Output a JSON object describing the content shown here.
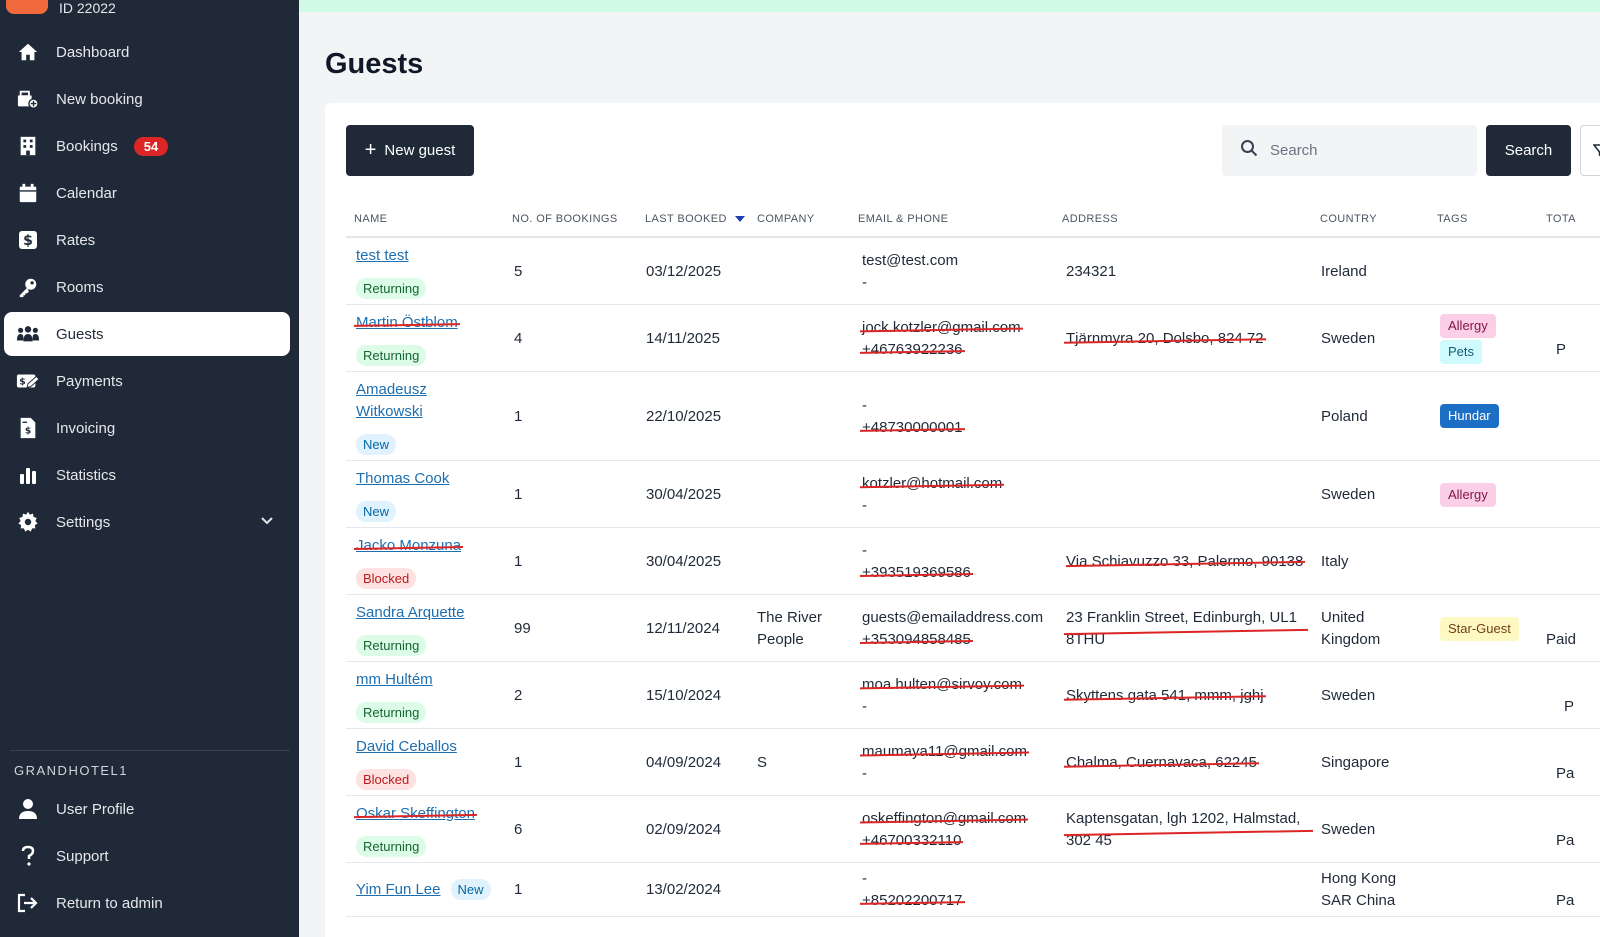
{
  "app": {
    "property_id": "ID 22022",
    "page_title": "Guests",
    "section_title": "GRANDHOTEL1"
  },
  "sidebar": {
    "items": [
      {
        "label": "Dashboard",
        "icon": "home-icon"
      },
      {
        "label": "New booking",
        "icon": "new-booking-icon"
      },
      {
        "label": "Bookings",
        "icon": "building-icon",
        "badge": "54"
      },
      {
        "label": "Calendar",
        "icon": "calendar-icon"
      },
      {
        "label": "Rates",
        "icon": "dollar-icon"
      },
      {
        "label": "Rooms",
        "icon": "key-icon"
      },
      {
        "label": "Guests",
        "icon": "people-icon",
        "active": true
      },
      {
        "label": "Payments",
        "icon": "payment-icon"
      },
      {
        "label": "Invoicing",
        "icon": "invoice-icon"
      },
      {
        "label": "Statistics",
        "icon": "chart-icon"
      },
      {
        "label": "Settings",
        "icon": "gear-icon"
      }
    ],
    "bottom_items": [
      {
        "label": "User Profile",
        "icon": "user-icon"
      },
      {
        "label": "Support",
        "icon": "question-icon"
      },
      {
        "label": "Return to admin",
        "icon": "exit-icon"
      }
    ]
  },
  "toolbar": {
    "new_guest_label": "New guest",
    "search_placeholder": "Search",
    "search_button_label": "Search"
  },
  "table": {
    "columns": [
      "NAME",
      "NO. OF BOOKINGS",
      "LAST BOOKED",
      "COMPANY",
      "EMAIL & PHONE",
      "ADDRESS",
      "COUNTRY",
      "TAGS",
      "TOTA"
    ],
    "rows": [
      {
        "name": "test test",
        "status": "Returning",
        "bookings": "5",
        "last_booked": "03/12/2025",
        "company": "",
        "email": "test@test.com",
        "phone": "-",
        "address": "234321",
        "country": "Ireland",
        "tags": [],
        "total": ""
      },
      {
        "name": "Martin Östblom",
        "status": "Returning",
        "bookings": "4",
        "last_booked": "14/11/2025",
        "company": "",
        "email": "jock.kotzler@gmail.com",
        "phone": "+46763922236",
        "address": "Tjärnmyra 20, Dolsbo, 824 72",
        "country": "Sweden",
        "tags": [
          "Allergy",
          "Pets"
        ],
        "total": "P"
      },
      {
        "name": "Amadeusz Witkowski",
        "status": "New",
        "bookings": "1",
        "last_booked": "22/10/2025",
        "company": "",
        "email": "-",
        "phone": "+48730000001",
        "address": "",
        "country": "Poland",
        "tags": [
          "Hundar"
        ],
        "total": ""
      },
      {
        "name": "Thomas Cook",
        "status": "New",
        "bookings": "1",
        "last_booked": "30/04/2025",
        "company": "",
        "email": "kotzler@hotmail.com",
        "phone": "-",
        "address": "",
        "country": "Sweden",
        "tags": [
          "Allergy"
        ],
        "total": ""
      },
      {
        "name": "Jacko Monzuna",
        "status": "Blocked",
        "bookings": "1",
        "last_booked": "30/04/2025",
        "company": "",
        "email": "-",
        "phone": "+393519369586",
        "address": "Via Schiavuzzo 33, Palermo, 90138",
        "country": "Italy",
        "tags": [],
        "total": ""
      },
      {
        "name": "Sandra Arquette",
        "status": "Returning",
        "bookings": "99",
        "last_booked": "12/11/2024",
        "company": "The River People",
        "email": "guests@emailaddress.com",
        "phone": "+353094858485",
        "address": "23 Franklin Street, Edinburgh, UL1 8THU",
        "country": "United Kingdom",
        "tags": [
          "Star-Guest"
        ],
        "total": "Paid"
      },
      {
        "name": "mm Hultém",
        "status": "Returning",
        "bookings": "2",
        "last_booked": "15/10/2024",
        "company": "",
        "email": "moa.hulten@sirvoy.com",
        "phone": "-",
        "address": "Skyttens gata 541, mmm, jghj",
        "country": "Sweden",
        "tags": [],
        "total": "P"
      },
      {
        "name": "David Ceballos",
        "status": "Blocked",
        "bookings": "1",
        "last_booked": "04/09/2024",
        "company": "S",
        "email": "maumaya11@gmail.com",
        "phone": "-",
        "address": "Chalma, Cuernavaca, 62245",
        "country": "Singapore",
        "tags": [],
        "total": "Pa"
      },
      {
        "name": "Oskar Skeffington",
        "status": "Returning",
        "bookings": "6",
        "last_booked": "02/09/2024",
        "company": "",
        "email": "oskeffington@gmail.com",
        "phone": "+46700332110",
        "address": "Kaptensgatan, lgh 1202, Halmstad, 302 45",
        "country": "Sweden",
        "tags": [],
        "total": "Pa"
      },
      {
        "name": "Yim Fun Lee",
        "status": "New",
        "bookings": "1",
        "last_booked": "13/02/2024",
        "company": "",
        "email": "-",
        "phone": "+85202200717",
        "address": "",
        "country": "Hong Kong SAR China",
        "tags": [],
        "total": "Pa"
      }
    ]
  },
  "colors": {
    "sidebar_bg": "#1f2937",
    "badge_red": "#dc2626",
    "link_blue": "#1e6fb0",
    "strike_red": "#dc2626"
  }
}
